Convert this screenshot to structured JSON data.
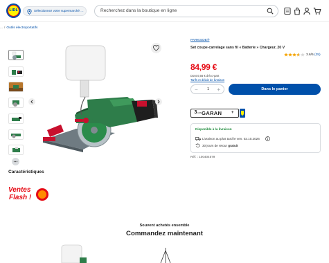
{
  "header": {
    "logo_text": "LIDL",
    "store_selector": "Sélectionnez votre supermarché Lidl pr...",
    "search_placeholder": "Recherchez dans la boutique en ligne"
  },
  "breadcrumb": {
    "prefix": "...",
    "item": "Outils électroportatifs"
  },
  "product": {
    "brand": "PARKSIDE®",
    "title": "Set coupe-carrelage sans fil « Batterie » Chargeur, 20 V",
    "rating": "3.6/5",
    "reviews": "(25)",
    "stars": 3.6,
    "price": "84,99 €",
    "eco_tax": "Dont 0,56 € d'éco-part",
    "shipping_link": "Tarifs et délais de livraison",
    "quantity": "1",
    "qty_minus": "−",
    "qty_plus": "+",
    "add_to_cart": "Dans le panier",
    "warranty": {
      "years": "3",
      "unit": "ANS",
      "word": "GARAN",
      "plus": "+"
    },
    "availability": {
      "status": "Disponible à la livraison",
      "delivery": "Livraison au plus tard le ven. 02.10.2026",
      "returns_prefix": "30 jours de retour",
      "returns_suffix": "gratuit"
    },
    "reference": "Réf. : 100404579"
  },
  "sections": {
    "characteristics": "Caractéristiques",
    "flash_line1": "Ventes",
    "flash_line2": "Flash !",
    "reco_subtitle": "Souvent achetés ensemble",
    "reco_title": "Commandez maintenant"
  },
  "colors": {
    "brand_blue": "#0050aa",
    "price_red": "#e60a14",
    "available_green": "#1c8a3a"
  },
  "icons": [
    "location-icon",
    "search-icon",
    "receipt-icon",
    "bag-icon",
    "user-icon",
    "cart-icon",
    "heart-icon",
    "chevron-left-icon",
    "chevron-right-icon",
    "truck-icon",
    "info-icon",
    "return-icon"
  ]
}
